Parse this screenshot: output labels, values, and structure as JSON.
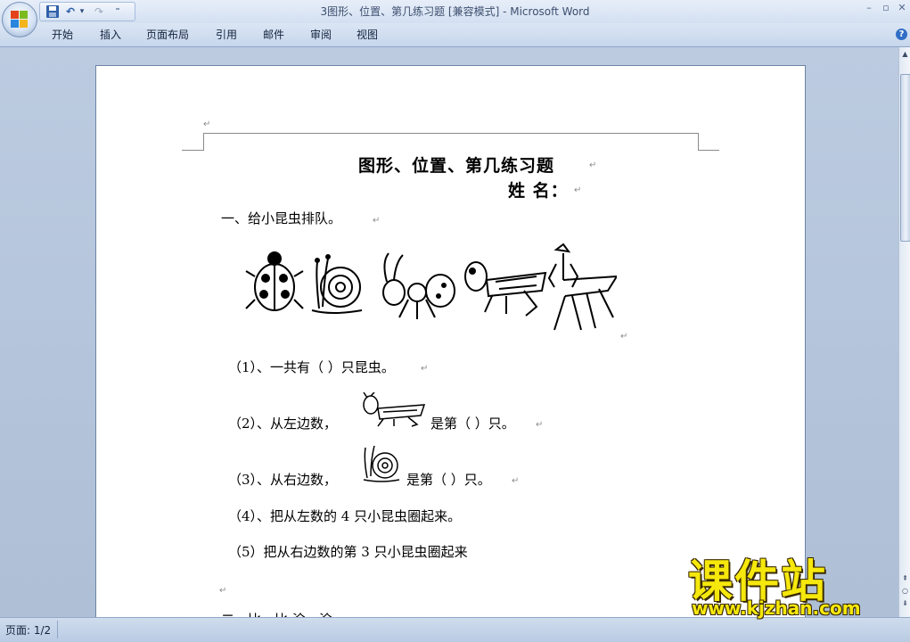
{
  "window": {
    "title": "3图形、位置、第几练习题 [兼容模式] - Microsoft Word",
    "minimize": "–",
    "restore": "▫",
    "close": "✕"
  },
  "qat": {
    "save_icon": "save-icon",
    "undo_icon": "undo-icon",
    "redo_icon": "redo-icon",
    "undo_glyph": "↶",
    "redo_glyph": "↷",
    "dropdown_glyph": "▾",
    "customize_glyph": "⁼"
  },
  "ribbon": {
    "tabs": [
      "开始",
      "插入",
      "页面布局",
      "引用",
      "邮件",
      "审阅",
      "视图"
    ],
    "help_glyph": "?"
  },
  "document": {
    "title": "图形、位置、第几练习题",
    "name_label": "姓  名：",
    "section1": "一、给小昆虫排队。",
    "insects": [
      "ladybug",
      "snail",
      "ant",
      "grasshopper",
      "mantis"
    ],
    "questions": [
      "（1）、一共有（  ）只昆虫。",
      "（2）、从左边数，",
      "是第（    ）只。",
      "（3）、从右边数，",
      "是第（    ）只。",
      "（4）、把从左数的 4 只小昆虫圈起来。",
      "（5）把从右边数的第 3 只小昆虫圈起来"
    ],
    "section2_partial": "二、比一比 涂一涂",
    "para_mark": "↵"
  },
  "scrollbar": {
    "up_glyph": "▲",
    "down_glyph": "▼",
    "prev_page_glyph": "⇞",
    "select_browse_glyph": "○",
    "next_page_glyph": "⇟"
  },
  "status": {
    "page": "页面: 1/2"
  },
  "watermark": {
    "brand": "课件站",
    "url": "www.kjzhan.com"
  }
}
